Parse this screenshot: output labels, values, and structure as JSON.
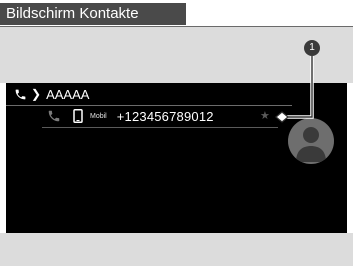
{
  "header": {
    "title": "Bildschirm Kontakte"
  },
  "breadcrumb": {
    "contact_name": "AAAAA"
  },
  "entry": {
    "type_label": "Mobil",
    "number": "+123456789012",
    "star_glyph": "★"
  },
  "callout": {
    "number": "1"
  },
  "icons": {
    "breadcrumb_icon": "phone-icon",
    "entry_call_icon": "phone-icon",
    "entry_type_icon": "mobile-phone-icon",
    "favorite_icon": "star-icon",
    "contact_image": "avatar-silhouette"
  },
  "colors": {
    "screen_background": "#000000",
    "band_background": "#dcdcdc",
    "header_background": "#4a4a4a",
    "avatar_background": "#6e6e6e"
  }
}
